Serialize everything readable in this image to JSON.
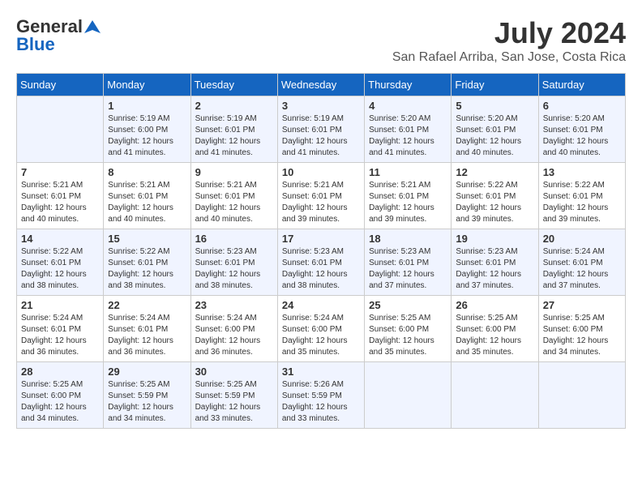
{
  "header": {
    "logo_line1": "General",
    "logo_line2": "Blue",
    "month": "July 2024",
    "location": "San Rafael Arriba, San Jose, Costa Rica"
  },
  "weekdays": [
    "Sunday",
    "Monday",
    "Tuesday",
    "Wednesday",
    "Thursday",
    "Friday",
    "Saturday"
  ],
  "weeks": [
    [
      {
        "day": "",
        "info": ""
      },
      {
        "day": "1",
        "info": "Sunrise: 5:19 AM\nSunset: 6:00 PM\nDaylight: 12 hours\nand 41 minutes."
      },
      {
        "day": "2",
        "info": "Sunrise: 5:19 AM\nSunset: 6:01 PM\nDaylight: 12 hours\nand 41 minutes."
      },
      {
        "day": "3",
        "info": "Sunrise: 5:19 AM\nSunset: 6:01 PM\nDaylight: 12 hours\nand 41 minutes."
      },
      {
        "day": "4",
        "info": "Sunrise: 5:20 AM\nSunset: 6:01 PM\nDaylight: 12 hours\nand 41 minutes."
      },
      {
        "day": "5",
        "info": "Sunrise: 5:20 AM\nSunset: 6:01 PM\nDaylight: 12 hours\nand 40 minutes."
      },
      {
        "day": "6",
        "info": "Sunrise: 5:20 AM\nSunset: 6:01 PM\nDaylight: 12 hours\nand 40 minutes."
      }
    ],
    [
      {
        "day": "7",
        "info": "Sunrise: 5:21 AM\nSunset: 6:01 PM\nDaylight: 12 hours\nand 40 minutes."
      },
      {
        "day": "8",
        "info": "Sunrise: 5:21 AM\nSunset: 6:01 PM\nDaylight: 12 hours\nand 40 minutes."
      },
      {
        "day": "9",
        "info": "Sunrise: 5:21 AM\nSunset: 6:01 PM\nDaylight: 12 hours\nand 40 minutes."
      },
      {
        "day": "10",
        "info": "Sunrise: 5:21 AM\nSunset: 6:01 PM\nDaylight: 12 hours\nand 39 minutes."
      },
      {
        "day": "11",
        "info": "Sunrise: 5:21 AM\nSunset: 6:01 PM\nDaylight: 12 hours\nand 39 minutes."
      },
      {
        "day": "12",
        "info": "Sunrise: 5:22 AM\nSunset: 6:01 PM\nDaylight: 12 hours\nand 39 minutes."
      },
      {
        "day": "13",
        "info": "Sunrise: 5:22 AM\nSunset: 6:01 PM\nDaylight: 12 hours\nand 39 minutes."
      }
    ],
    [
      {
        "day": "14",
        "info": "Sunrise: 5:22 AM\nSunset: 6:01 PM\nDaylight: 12 hours\nand 38 minutes."
      },
      {
        "day": "15",
        "info": "Sunrise: 5:22 AM\nSunset: 6:01 PM\nDaylight: 12 hours\nand 38 minutes."
      },
      {
        "day": "16",
        "info": "Sunrise: 5:23 AM\nSunset: 6:01 PM\nDaylight: 12 hours\nand 38 minutes."
      },
      {
        "day": "17",
        "info": "Sunrise: 5:23 AM\nSunset: 6:01 PM\nDaylight: 12 hours\nand 38 minutes."
      },
      {
        "day": "18",
        "info": "Sunrise: 5:23 AM\nSunset: 6:01 PM\nDaylight: 12 hours\nand 37 minutes."
      },
      {
        "day": "19",
        "info": "Sunrise: 5:23 AM\nSunset: 6:01 PM\nDaylight: 12 hours\nand 37 minutes."
      },
      {
        "day": "20",
        "info": "Sunrise: 5:24 AM\nSunset: 6:01 PM\nDaylight: 12 hours\nand 37 minutes."
      }
    ],
    [
      {
        "day": "21",
        "info": "Sunrise: 5:24 AM\nSunset: 6:01 PM\nDaylight: 12 hours\nand 36 minutes."
      },
      {
        "day": "22",
        "info": "Sunrise: 5:24 AM\nSunset: 6:01 PM\nDaylight: 12 hours\nand 36 minutes."
      },
      {
        "day": "23",
        "info": "Sunrise: 5:24 AM\nSunset: 6:00 PM\nDaylight: 12 hours\nand 36 minutes."
      },
      {
        "day": "24",
        "info": "Sunrise: 5:24 AM\nSunset: 6:00 PM\nDaylight: 12 hours\nand 35 minutes."
      },
      {
        "day": "25",
        "info": "Sunrise: 5:25 AM\nSunset: 6:00 PM\nDaylight: 12 hours\nand 35 minutes."
      },
      {
        "day": "26",
        "info": "Sunrise: 5:25 AM\nSunset: 6:00 PM\nDaylight: 12 hours\nand 35 minutes."
      },
      {
        "day": "27",
        "info": "Sunrise: 5:25 AM\nSunset: 6:00 PM\nDaylight: 12 hours\nand 34 minutes."
      }
    ],
    [
      {
        "day": "28",
        "info": "Sunrise: 5:25 AM\nSunset: 6:00 PM\nDaylight: 12 hours\nand 34 minutes."
      },
      {
        "day": "29",
        "info": "Sunrise: 5:25 AM\nSunset: 5:59 PM\nDaylight: 12 hours\nand 34 minutes."
      },
      {
        "day": "30",
        "info": "Sunrise: 5:25 AM\nSunset: 5:59 PM\nDaylight: 12 hours\nand 33 minutes."
      },
      {
        "day": "31",
        "info": "Sunrise: 5:26 AM\nSunset: 5:59 PM\nDaylight: 12 hours\nand 33 minutes."
      },
      {
        "day": "",
        "info": ""
      },
      {
        "day": "",
        "info": ""
      },
      {
        "day": "",
        "info": ""
      }
    ]
  ]
}
